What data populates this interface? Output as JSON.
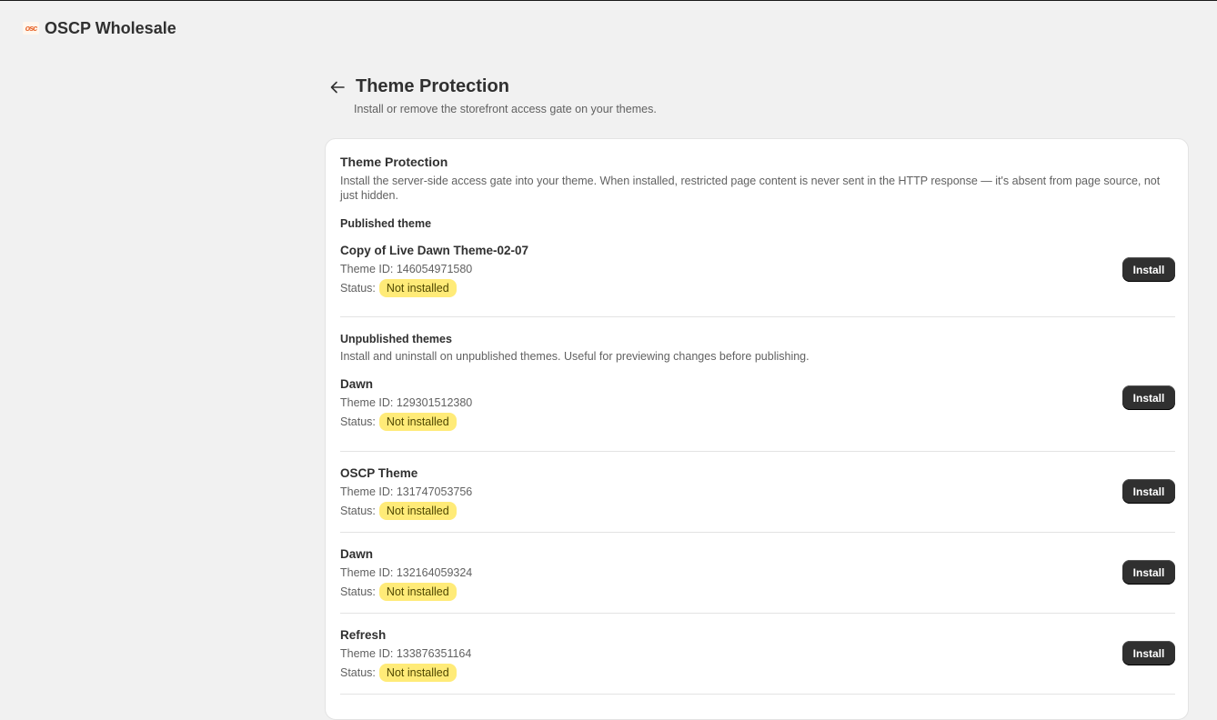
{
  "app": {
    "title": "OSCP Wholesale",
    "logo_text": "osc"
  },
  "page": {
    "title": "Theme Protection",
    "subtitle": "Install or remove the storefront access gate on your themes."
  },
  "card": {
    "title": "Theme Protection",
    "description": "Install the server-side access gate into your theme. When installed, restricted page content is never sent in the HTTP response — it's absent from page source, not just hidden."
  },
  "published": {
    "label": "Published theme",
    "theme": {
      "name": "Copy of Live Dawn Theme-02-07",
      "id_text": "Theme ID: 146054971580",
      "status_label": "Status:",
      "status": "Not installed",
      "button": "Install"
    }
  },
  "unpublished": {
    "label": "Unpublished themes",
    "description": "Install and uninstall on unpublished themes. Useful for previewing changes before publishing.",
    "themes": [
      {
        "name": "Dawn",
        "id_text": "Theme ID: 129301512380",
        "status_label": "Status:",
        "status": "Not installed",
        "button": "Install"
      },
      {
        "name": "OSCP Theme",
        "id_text": "Theme ID: 131747053756",
        "status_label": "Status:",
        "status": "Not installed",
        "button": "Install"
      },
      {
        "name": "Dawn",
        "id_text": "Theme ID: 132164059324",
        "status_label": "Status:",
        "status": "Not installed",
        "button": "Install"
      },
      {
        "name": "Refresh",
        "id_text": "Theme ID: 133876351164",
        "status_label": "Status:",
        "status": "Not installed",
        "button": "Install"
      }
    ]
  },
  "colors": {
    "badge_bg": "#ffeb78",
    "button_bg": "#303030",
    "page_bg": "#f1f1f1"
  },
  "icons": {
    "back": "arrow-left-icon",
    "logo": "app-logo-icon"
  }
}
